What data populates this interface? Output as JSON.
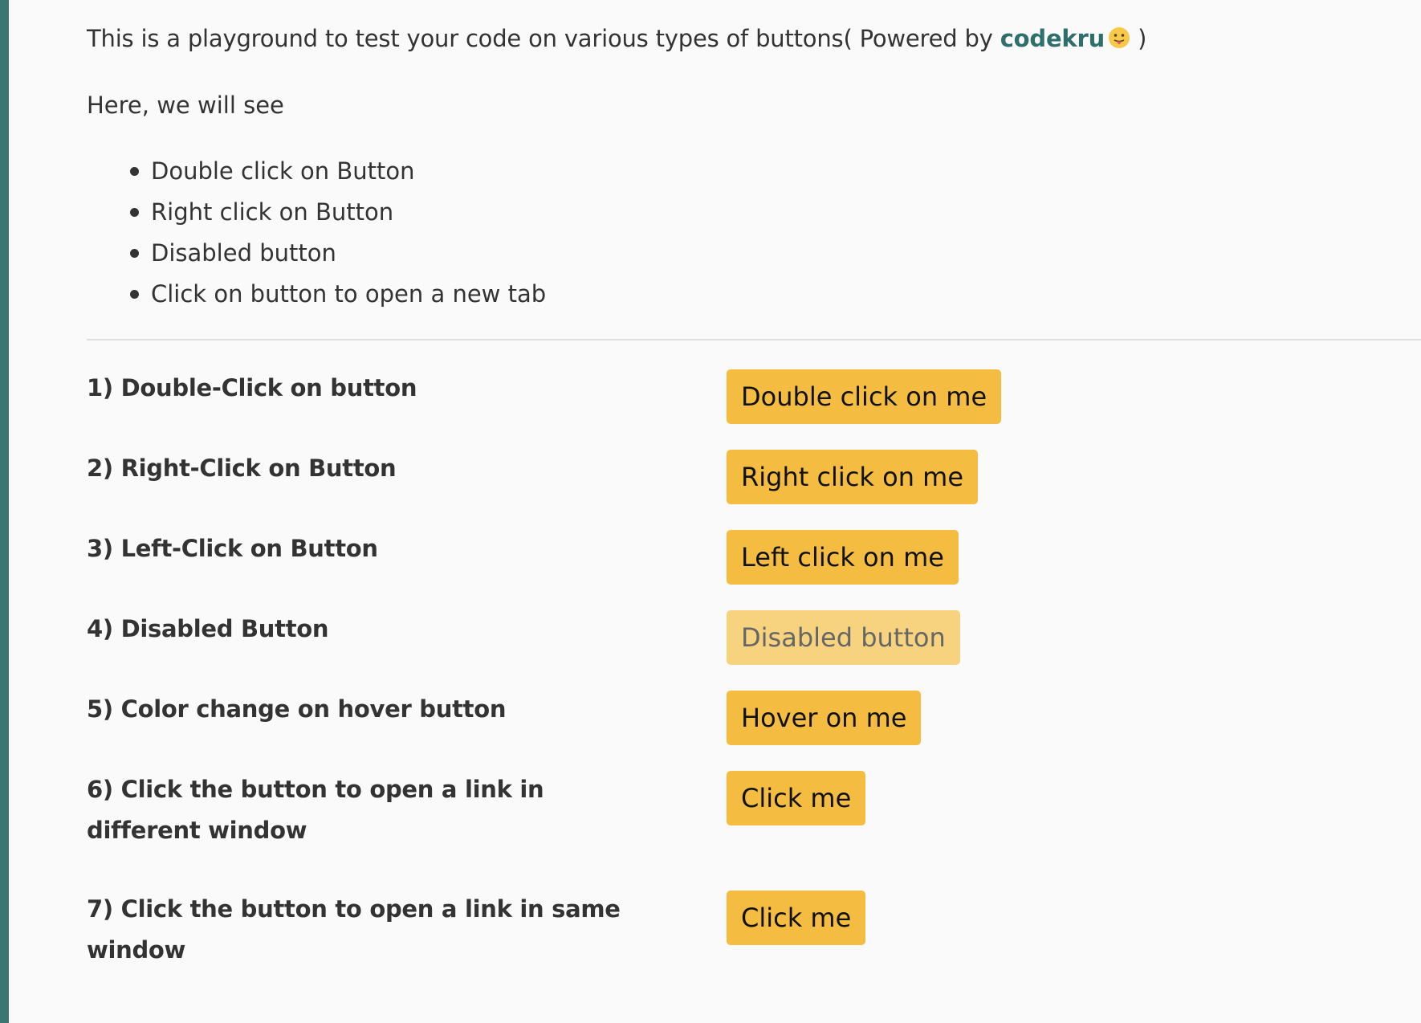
{
  "colors": {
    "left_bar": "#3a7672",
    "brand": "#2f6f6b",
    "button_bg": "#f4bd41",
    "button_disabled_bg": "#f7d37f",
    "emoji_face": "#f7c948"
  },
  "intro": {
    "text_before": "This is a playground to test your code on various types of buttons( Powered by ",
    "brand_link": "codekru",
    "emoji_icon": "face-with-tongue-icon",
    "text_after": " )"
  },
  "subhead": "Here, we will see",
  "features": [
    "Double click on Button",
    "Right click on Button",
    "Disabled button",
    "Click on button to open a new tab"
  ],
  "rows": [
    {
      "label": "1) Double-Click on button",
      "button": "Double click on me",
      "disabled": false
    },
    {
      "label": "2) Right-Click on Button",
      "button": "Right click on me",
      "disabled": false
    },
    {
      "label": "3) Left-Click on Button",
      "button": "Left click on me",
      "disabled": false
    },
    {
      "label": "4) Disabled Button",
      "button": "Disabled button",
      "disabled": true
    },
    {
      "label": "5) Color change on hover button",
      "button": "Hover on me",
      "disabled": false
    },
    {
      "label": "6) Click the button to open a link in different window",
      "button": "Click me",
      "disabled": false
    },
    {
      "label": "7) Click the button to open a link in same window",
      "button": "Click me",
      "disabled": false
    }
  ]
}
